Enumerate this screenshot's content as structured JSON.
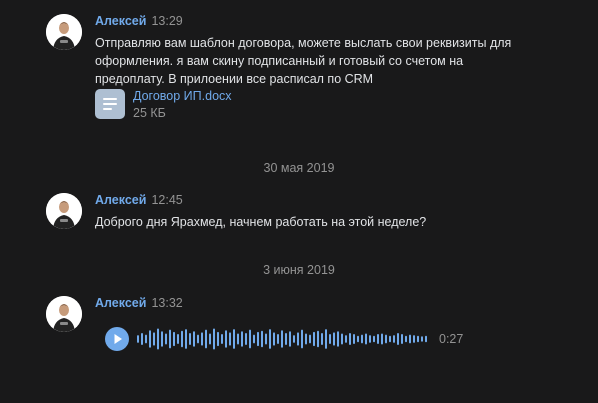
{
  "messages": [
    {
      "author": "Алексей",
      "time": "13:29",
      "text": "Отправляю вам шаблон договора, можете выслать свои реквизиты для оформления. я вам скину подписанный и готовый со счетом на предоплату. В прилоении все расписал по CRM",
      "attachment": {
        "icon": "document-icon",
        "name": "Договор ИП.docx",
        "size": "25 КБ"
      }
    },
    {
      "author": "Алексей",
      "time": "12:45",
      "text": "Доброго дня Ярахмед, начнем работать на этой неделе?"
    },
    {
      "author": "Алексей",
      "time": "13:32",
      "audio": {
        "icon": "play-icon",
        "duration": "0:27",
        "played_fraction": 0,
        "waveform_levels": [
          0.35,
          0.55,
          0.4,
          0.8,
          0.6,
          0.95,
          0.7,
          0.5,
          0.85,
          0.65,
          0.45,
          0.75,
          0.9,
          0.55,
          0.7,
          0.4,
          0.6,
          0.85,
          0.5,
          0.95,
          0.65,
          0.45,
          0.8,
          0.6,
          0.9,
          0.5,
          0.7,
          0.55,
          0.85,
          0.4,
          0.65,
          0.75,
          0.5,
          0.9,
          0.6,
          0.45,
          0.8,
          0.55,
          0.7,
          0.35,
          0.6,
          0.85,
          0.5,
          0.4,
          0.65,
          0.75,
          0.55,
          0.9,
          0.45,
          0.6,
          0.7,
          0.5,
          0.35,
          0.55,
          0.45,
          0.3,
          0.4,
          0.5,
          0.35,
          0.3,
          0.45,
          0.5,
          0.4,
          0.3,
          0.35,
          0.55,
          0.45,
          0.3,
          0.4,
          0.35,
          0.3,
          0.25,
          0.3
        ]
      }
    }
  ],
  "date_separators": [
    "30 мая 2019",
    "3 июня 2019"
  ],
  "colors": {
    "background": "#19191a",
    "author": "#71aaeb",
    "link": "#71aaeb",
    "muted": "#939393",
    "text": "#e1e3e6",
    "waveform": "#71aaeb",
    "file_icon": "#aebfd2"
  }
}
